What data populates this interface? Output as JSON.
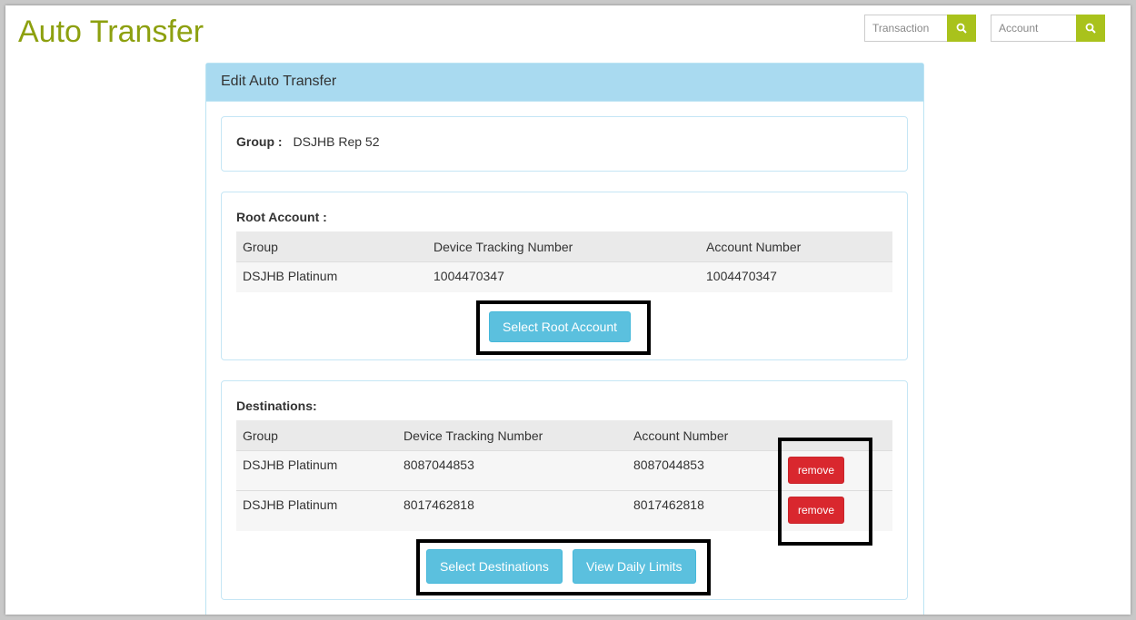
{
  "app": {
    "title": "Auto Transfer"
  },
  "search": {
    "transaction_placeholder": "Transaction",
    "account_placeholder": "Account"
  },
  "panel": {
    "heading": "Edit Auto Transfer"
  },
  "group": {
    "label": "Group :",
    "value": "DSJHB Rep 52"
  },
  "root_account": {
    "label": "Root Account :",
    "columns": [
      "Group",
      "Device Tracking Number",
      "Account Number"
    ],
    "rows": [
      {
        "group": "DSJHB Platinum",
        "device": "1004470347",
        "account": "1004470347"
      }
    ],
    "select_button": "Select Root Account"
  },
  "destinations": {
    "label": "Destinations:",
    "columns": [
      "Group",
      "Device Tracking Number",
      "Account Number"
    ],
    "rows": [
      {
        "group": "DSJHB Platinum",
        "device": "8087044853",
        "account": "8087044853",
        "remove": "remove"
      },
      {
        "group": "DSJHB Platinum",
        "device": "8017462818",
        "account": "8017462818",
        "remove": "remove"
      }
    ],
    "select_button": "Select Destinations",
    "limits_button": "View Daily Limits"
  },
  "colors": {
    "title": "#8da00f",
    "search_button": "#a9c21c",
    "panel_heading": "#a9daf0",
    "info_button": "#5bc0de",
    "danger_button": "#d9272e"
  },
  "icons": [
    "search-icon",
    "search-icon"
  ]
}
